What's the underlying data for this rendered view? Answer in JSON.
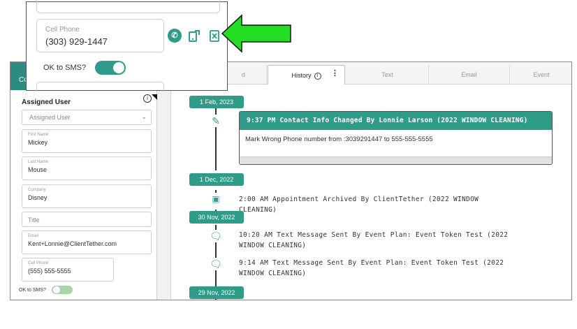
{
  "popup": {
    "cell_phone_label": "Cell Phone",
    "cell_phone_value": "(303) 929-1447",
    "ok_to_sms_label": "OK to SMS?",
    "ok_to_sms_on": true,
    "icons": [
      "call-icon",
      "edit-phone-icon",
      "mark-wrong-number-icon"
    ]
  },
  "left_panel": {
    "header_text": "Co",
    "assigned_user_label": "Assigned User",
    "assigned_user_select": "Assigned User",
    "fields": [
      {
        "label": "First Name",
        "value": "Mickey"
      },
      {
        "label": "Last Name",
        "value": "Mouse"
      },
      {
        "label": "Company",
        "value": "Disney"
      },
      {
        "label": "",
        "value": "Title"
      },
      {
        "label": "Email",
        "value": "Kent+Lonnie@ClientTether.com"
      },
      {
        "label": "Cell Phone",
        "value": "(555) 555-5555"
      }
    ],
    "ok_to_sms_label": "OK to SMS?",
    "ok_to_sms_on": false
  },
  "tabs": [
    {
      "label": "d",
      "active": false
    },
    {
      "label": "History",
      "active": true
    },
    {
      "label": "Text",
      "active": false
    },
    {
      "label": "Email",
      "active": false
    },
    {
      "label": "Event",
      "active": false
    }
  ],
  "timeline": {
    "dates": [
      "1 Feb, 2023",
      "1 Dec, 2022",
      "30 Nov, 2022",
      "29 Nov, 2022"
    ],
    "card": {
      "title": "9:37 PM Contact Info Changed By Lonnie Larson (2022 WINDOW CLEANING)",
      "body": "Mark Wrong Phone number from :3039291447 to 555-555-5555"
    },
    "entries": [
      {
        "text": "2:00 AM Appointment Archived By ClientTether (2022 WINDOW CLEANING)",
        "icon": "calendar-icon"
      },
      {
        "text": "10:20 AM Text Message Sent By Event Plan: Event Token Test (2022 WINDOW CLEANING)",
        "icon": "chat-icon"
      },
      {
        "text": "9:14 AM Text Message Sent By Event Plan: Event Token Test (2022 WINDOW CLEANING)",
        "icon": "chat-icon"
      }
    ]
  },
  "colors": {
    "accent": "#2e9c88",
    "arrow": "#22dd22"
  }
}
